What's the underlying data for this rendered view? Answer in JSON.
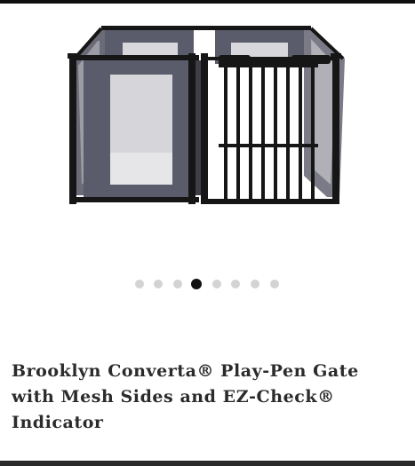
{
  "product": {
    "title": "Brooklyn Converta® Play-Pen Gate with Mesh Sides and EZ-Check® Indicator"
  },
  "gallery": {
    "total_images": 8,
    "active_index": 3
  },
  "colors": {
    "frame": "#161616",
    "mesh_panel": "#5a5c6b",
    "mesh_window": "#dcdcde",
    "dot_inactive": "#d3d3d3",
    "dot_active": "#111111",
    "title_text": "#2b2b2b"
  }
}
